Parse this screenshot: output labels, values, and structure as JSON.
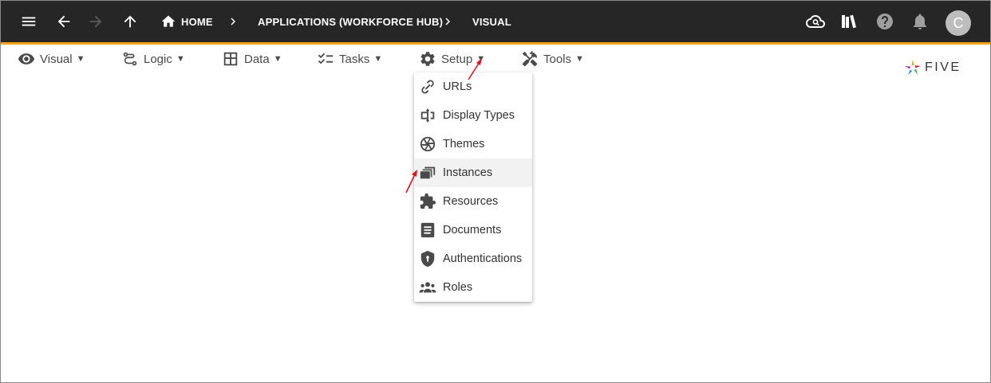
{
  "topbar": {
    "breadcrumbs": [
      {
        "label": "HOME"
      },
      {
        "label": "APPLICATIONS (WORKFORCE HUB)"
      },
      {
        "label": "VISUAL"
      }
    ],
    "avatar_initial": "C"
  },
  "menubar": {
    "items": [
      {
        "label": "Visual",
        "icon": "eye-icon"
      },
      {
        "label": "Logic",
        "icon": "flow-icon"
      },
      {
        "label": "Data",
        "icon": "table-icon"
      },
      {
        "label": "Tasks",
        "icon": "checklist-icon"
      },
      {
        "label": "Setup",
        "icon": "gear-icon"
      },
      {
        "label": "Tools",
        "icon": "tools-icon"
      }
    ],
    "caret": "▼"
  },
  "logo": {
    "text": "FIVE"
  },
  "dropdown": {
    "items": [
      {
        "label": "URLs",
        "icon": "link-icon"
      },
      {
        "label": "Display Types",
        "icon": "display-type-icon"
      },
      {
        "label": "Themes",
        "icon": "aperture-icon"
      },
      {
        "label": "Instances",
        "icon": "stacked-windows-icon"
      },
      {
        "label": "Resources",
        "icon": "puzzle-icon"
      },
      {
        "label": "Documents",
        "icon": "document-icon"
      },
      {
        "label": "Authentications",
        "icon": "shield-icon"
      },
      {
        "label": "Roles",
        "icon": "group-icon"
      }
    ],
    "highlighted": "Instances"
  },
  "colors": {
    "topbar": "#262626",
    "accent": "#f2a51a",
    "annotation_arrow": "#e0141e"
  }
}
